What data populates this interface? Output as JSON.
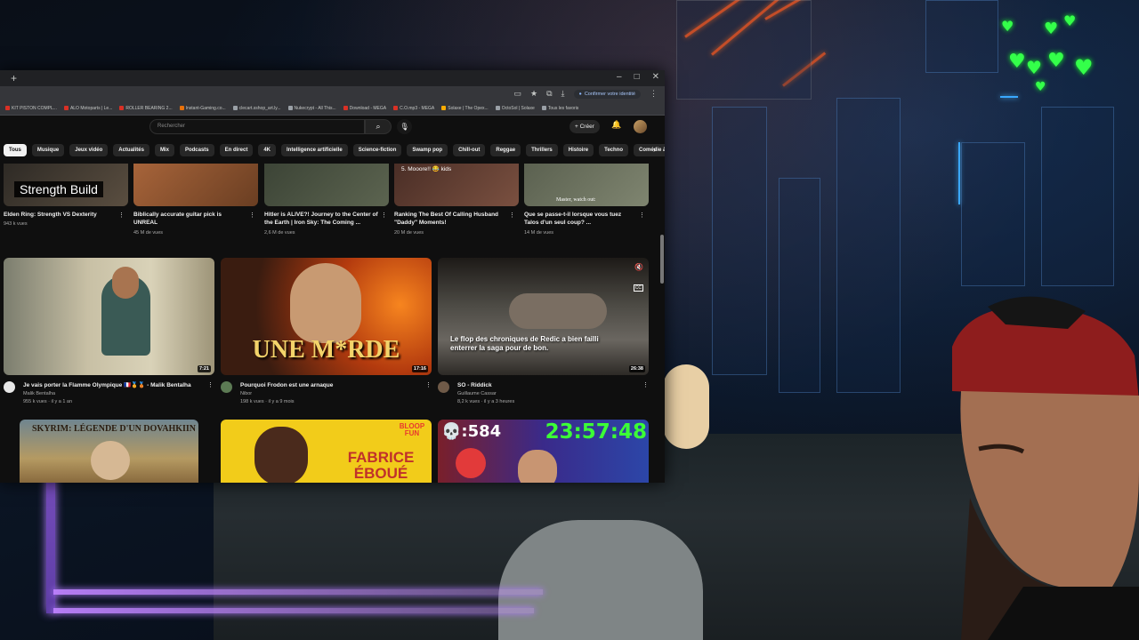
{
  "browser": {
    "new_tab": "+",
    "window_controls": [
      "–",
      "□",
      "✕"
    ],
    "confirm_identity": "Confirmer votre identité",
    "bookmarks": [
      {
        "label": "KIT PISTON COMPL...",
        "color": "#d93025"
      },
      {
        "label": "ALO Motoparts | Le...",
        "color": "#d93025"
      },
      {
        "label": "ROLLER BEARING 2...",
        "color": "#d93025"
      },
      {
        "label": "Instant-Gaming.co...",
        "color": "#e8710a"
      },
      {
        "label": "clecart.sshop_art.ly...",
        "color": "#9aa0a6"
      },
      {
        "label": "Nukecrypt - All This...",
        "color": "#9aa0a6"
      },
      {
        "label": "Download - MEGA",
        "color": "#d93025"
      },
      {
        "label": "C.O.mp3 - MEGA",
        "color": "#d93025"
      },
      {
        "label": "Solaxe | The Opex...",
        "color": "#f9ab00"
      },
      {
        "label": "OctoSol | Solaxe",
        "color": "#9aa0a6"
      },
      {
        "label": "Tous les favoris",
        "color": "#9aa0a6"
      }
    ]
  },
  "youtube": {
    "search_placeholder": "Rechercher",
    "create_label": "Créer",
    "chips": [
      "Tous",
      "Musique",
      "Jeux vidéo",
      "Actualités",
      "Mix",
      "Podcasts",
      "En direct",
      "4K",
      "Intelligence artificielle",
      "Science-fiction",
      "Swamp pop",
      "Chill-out",
      "Reggae",
      "Thrillers",
      "Histoire",
      "Techno",
      "Comédie à sk..."
    ],
    "row1": [
      {
        "title": "Elden Ring: Strength VS Dexterity",
        "meta": "943 k vues",
        "overlay": "Strength Build"
      },
      {
        "title": "Biblically accurate guitar pick is UNREAL",
        "meta": "45 M de vues"
      },
      {
        "title": "Hitler is ALIVE?! Journey to the Center of the Earth | Iron Sky: The Coming ...",
        "meta": "2,6 M de vues"
      },
      {
        "title": "Ranking The Best Of Calling Husband \"Daddy\" Moments!",
        "meta": "20 M de vues",
        "overlay": "5. Mooore!! 😂 kids"
      },
      {
        "title": "Que se passe-t-il lorsque vous tuez Talos d'un seul coup? ...",
        "meta": "14 M de vues",
        "overlay": "Master, watch out:"
      }
    ],
    "row2": [
      {
        "title": "Je vais porter la Flamme Olympique 🇫🇷🏅🥉 - Malik Bentalha",
        "channel": "Malik Bentalha",
        "meta": "955 k vues · il y a 1 an",
        "duration": "7:21"
      },
      {
        "title": "Pourquoi Frodon est une arnaque",
        "channel": "Nibor",
        "meta": "198 k vues · il y a 9 mois",
        "duration": "17:16",
        "overlay": "UNE M*RDE"
      },
      {
        "title": "SO - Riddick",
        "channel": "Guillaume Cassar",
        "meta": "8,2 k vues · il y a 3 heures",
        "duration": "26:38",
        "overlay": "Le flop des chroniques de Redic a bien failli enterrer la saga pour de bon."
      }
    ],
    "row3": [
      {
        "overlay": "SKYRIM: LÉGENDE D'UN DOVAHKIIN"
      },
      {
        "overlay": "FABRICE ÉBOUÉ",
        "badge": "BLOOP FUN"
      },
      {
        "overlay_count": "💀:584",
        "overlay_timer": "23:57:48"
      }
    ]
  },
  "stream": {
    "hearts": [
      "♥",
      "♥",
      "♥",
      "♥",
      "♥",
      "♥",
      "♥",
      "♥"
    ]
  }
}
